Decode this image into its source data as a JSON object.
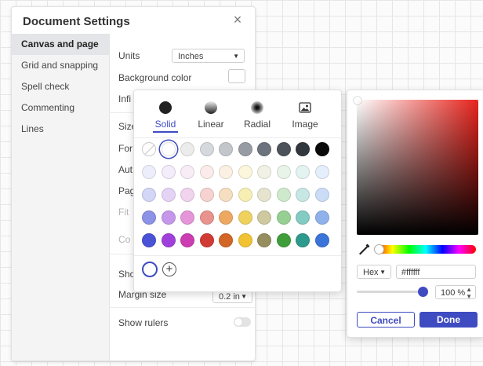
{
  "dialog": {
    "title": "Document Settings",
    "close_glyph": "×",
    "nav": [
      {
        "label": "Canvas and page",
        "active": true
      },
      {
        "label": "Grid and snapping"
      },
      {
        "label": "Spell check"
      },
      {
        "label": "Commenting"
      },
      {
        "label": "Lines"
      }
    ],
    "units_label": "Units",
    "units_value": "Inches",
    "background_color_label": "Background color",
    "infinite_label": "Infi",
    "size_label": "Size",
    "format_label": "For",
    "auto_label": "Aut",
    "page_label": "Pag",
    "fit_label": "Fit",
    "color_label": "Co",
    "show_label": "Sho",
    "margin_label": "Margin size",
    "margin_value": "0.2 in",
    "show_rulers_label": "Show rulers"
  },
  "fill_picker": {
    "tabs": [
      {
        "label": "Solid",
        "active": true
      },
      {
        "label": "Linear"
      },
      {
        "label": "Radial"
      },
      {
        "label": "Image"
      }
    ],
    "palette": [
      [
        "none",
        "#ffffff",
        "#ececec",
        "#d5d8dc",
        "#c3c7cc",
        "#979ca4",
        "#6d737c",
        "#4c5259",
        "#32373d",
        "#0a0a0a"
      ],
      [
        "#eceefb",
        "#f3ecfb",
        "#f8ecf6",
        "#fbeceb",
        "#fbf1e3",
        "#fbf6dc",
        "#f1f1e6",
        "#e8f4e7",
        "#e3f3f1",
        "#e5eefb"
      ],
      [
        "#d3d6f6",
        "#e5d3f6",
        "#f2d3ee",
        "#f6d3d1",
        "#f6dfc0",
        "#f7eeb4",
        "#e6e4cf",
        "#cfe9cd",
        "#c6e7e3",
        "#cbdcf6"
      ],
      [
        "#8c92e6",
        "#c596ea",
        "#e596d9",
        "#e9938e",
        "#eda861",
        "#efd15d",
        "#cfc9a0",
        "#96cf92",
        "#84cbc4",
        "#8fb1ec"
      ],
      [
        "#4a52d6",
        "#a040dc",
        "#cc3cb2",
        "#d23a34",
        "#d16626",
        "#f1c232",
        "#978e5f",
        "#3f9e3a",
        "#2e9a8d",
        "#3b74d9"
      ]
    ],
    "selected": "#ffffff",
    "add_glyph": "+"
  },
  "color_picker": {
    "hue_color": "#e8231c",
    "format": "Hex",
    "hex_value": "#ffffff",
    "opacity": "100 %",
    "cancel_label": "Cancel",
    "done_label": "Done"
  },
  "colors": {
    "accent": "#3f4bc1"
  }
}
